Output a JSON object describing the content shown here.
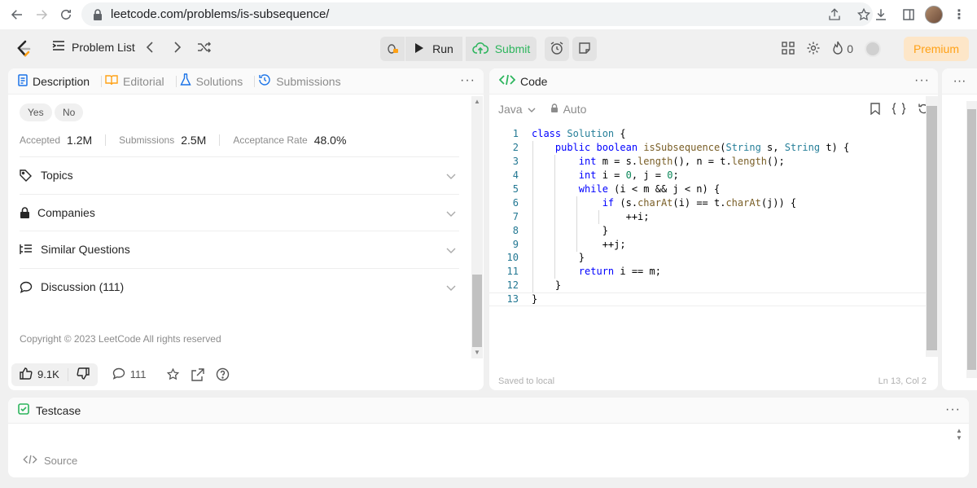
{
  "browser": {
    "url": "leetcode.com/problems/is-subsequence/"
  },
  "toolbar": {
    "problem_list": "Problem List",
    "run": "Run",
    "submit": "Submit",
    "streak": "0",
    "premium": "Premium"
  },
  "left": {
    "tabs": [
      "Description",
      "Editorial",
      "Solutions",
      "Submissions"
    ],
    "feedback": [
      "Yes",
      "No"
    ],
    "stats": [
      {
        "label": "Accepted",
        "value": "1.2M"
      },
      {
        "label": "Submissions",
        "value": "2.5M"
      },
      {
        "label": "Acceptance Rate",
        "value": "48.0%"
      }
    ],
    "sections": [
      "Topics",
      "Companies",
      "Similar Questions",
      "Discussion (111)"
    ],
    "copyright": "Copyright © 2023 LeetCode All rights reserved",
    "likes": "9.1K",
    "comments": "111"
  },
  "code": {
    "title": "Code",
    "language": "Java",
    "auto": "Auto",
    "saved": "Saved to local",
    "cursor": "Ln 13, Col 2",
    "lines": [
      "class Solution {",
      "    public boolean isSubsequence(String s, String t) {",
      "        int m = s.length(), n = t.length();",
      "        int i = 0, j = 0;",
      "        while (i < m && j < n) {",
      "            if (s.charAt(i) == t.charAt(j)) {",
      "                ++i;",
      "            }",
      "            ++j;",
      "        }",
      "        return i == m;",
      "    }",
      "}"
    ]
  },
  "bottom": {
    "title": "Testcase",
    "source": "Source"
  },
  "colors": {
    "accent": "#ffa116",
    "submit": "#2db55d",
    "keyword": "#0000ff"
  }
}
